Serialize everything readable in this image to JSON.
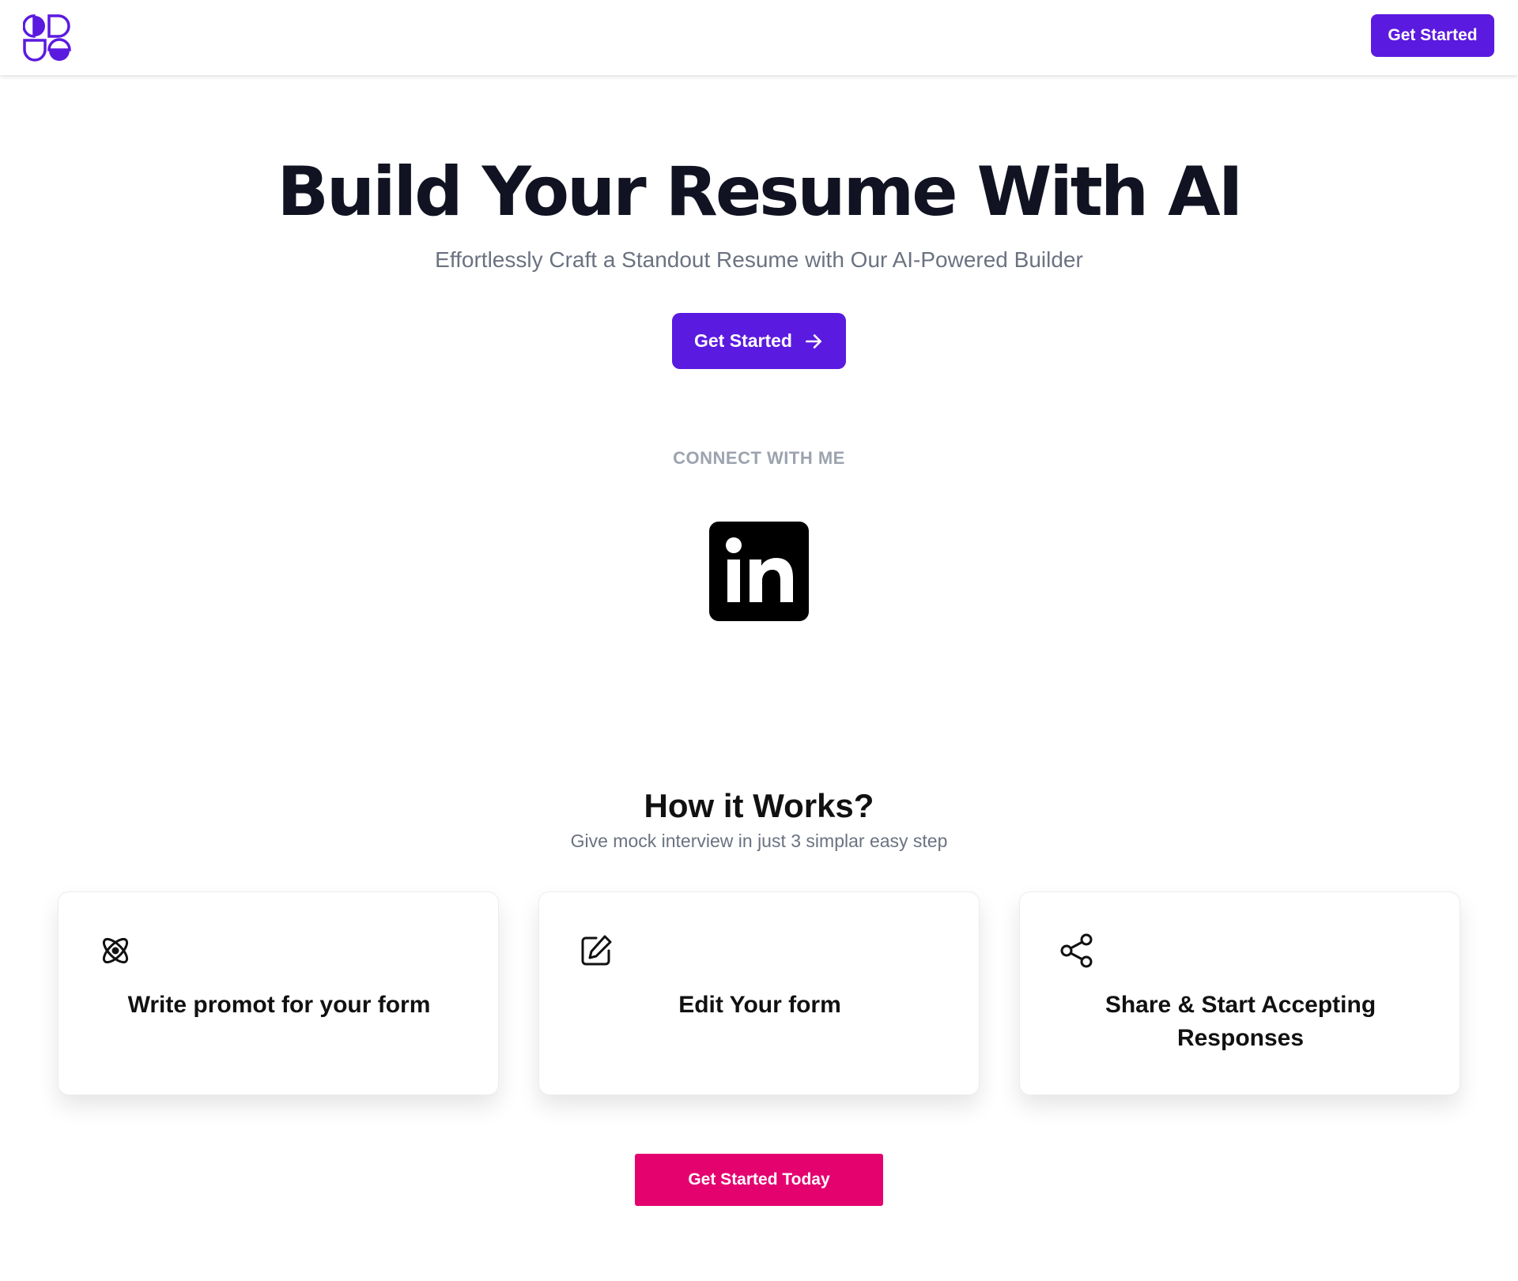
{
  "header": {
    "logo_icon": "brand-logo-icon",
    "cta_label": "Get Started"
  },
  "hero": {
    "title": "Build Your Resume With AI",
    "subtitle": "Effortlessly Craft a Standout Resume with Our AI-Powered Builder",
    "cta_label": "Get Started",
    "cta_icon": "arrow-right-icon"
  },
  "connect": {
    "label": "CONNECT WITH ME",
    "icon": "linkedin-icon",
    "icon_text": "in"
  },
  "how": {
    "title": "How it Works?",
    "subtitle": "Give mock interview in just 3 simplar easy step",
    "cards": [
      {
        "icon": "atom-icon",
        "title": "Write promot for your form"
      },
      {
        "icon": "edit-icon",
        "title": "Edit Your form"
      },
      {
        "icon": "share-icon",
        "title": "Share & Start Accepting Responses"
      }
    ]
  },
  "footer_cta": {
    "label": "Get Started Today"
  },
  "colors": {
    "primary": "#5b1adf",
    "accent_pink": "#e4026f",
    "heading": "#111322",
    "muted": "#6b7280"
  }
}
